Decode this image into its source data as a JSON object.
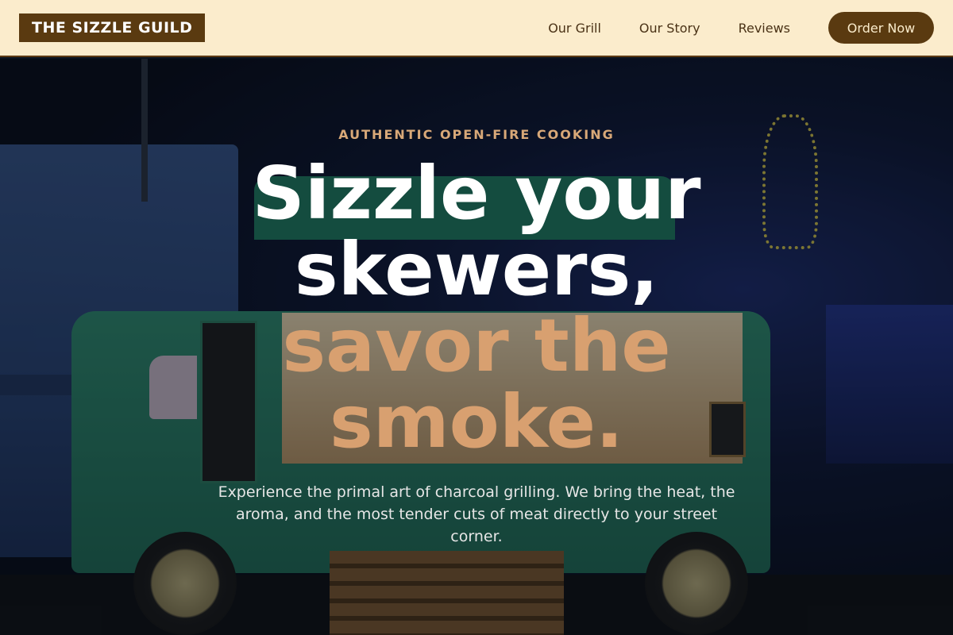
{
  "header": {
    "logo": "THE SIZZLE GUILD",
    "nav": [
      {
        "label": "Our Grill"
      },
      {
        "label": "Our Story"
      },
      {
        "label": "Reviews"
      }
    ],
    "cta_label": "Order Now"
  },
  "hero": {
    "eyebrow": "AUTHENTIC OPEN-FIRE COOKING",
    "headline_line1": "Sizzle your",
    "headline_line2": "skewers,",
    "headline_line3": "savor the",
    "headline_line4": "smoke.",
    "subtext": "Experience the primal art of charcoal grilling. We bring the heat, the aroma, and the most tender cuts of meat directly to your street corner.",
    "background_image": "food-truck-at-night"
  },
  "colors": {
    "brand_brown": "#5a3a10",
    "header_bg": "#fbeccc",
    "accent_tan": "#d8a070"
  }
}
